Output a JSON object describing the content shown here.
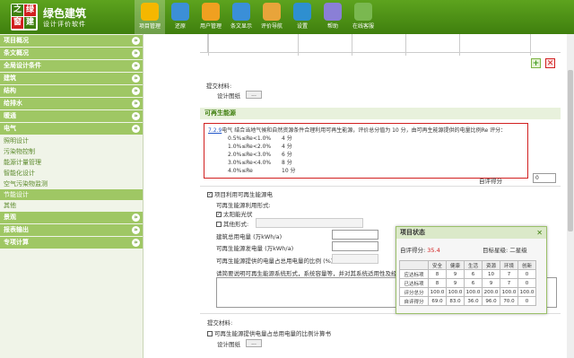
{
  "app": {
    "title_line1": "绿色建筑",
    "title_line2": "设计评价软件",
    "logo_chars": [
      "之",
      "绿",
      "窗",
      "建"
    ]
  },
  "toolbar": [
    {
      "label": "项目管理",
      "icon": "folder-icon",
      "color": "#f5b700",
      "name": "toolbar-project-management"
    },
    {
      "label": "还原",
      "icon": "refresh-icon",
      "color": "#3c8fd6",
      "name": "toolbar-restore"
    },
    {
      "label": "用户管理",
      "icon": "user-icon",
      "color": "#f0a020",
      "name": "toolbar-user-management"
    },
    {
      "label": "条文显示",
      "icon": "document-icon",
      "color": "#3a8fd8",
      "name": "toolbar-clause-display"
    },
    {
      "label": "评价导航",
      "icon": "navigation-icon",
      "color": "#e8a43a",
      "name": "toolbar-evaluation-nav"
    },
    {
      "label": "设置",
      "icon": "gear-icon",
      "color": "#2e8fd0",
      "name": "toolbar-settings"
    },
    {
      "label": "帮助",
      "icon": "help-icon",
      "color": "#8a7fd6",
      "name": "toolbar-help"
    },
    {
      "label": "在线客服",
      "icon": "support-icon",
      "color": "#7ab850",
      "name": "toolbar-online-service"
    }
  ],
  "sidebar": {
    "groups": [
      {
        "label": "项目概况",
        "toggle": "»"
      },
      {
        "label": "条文概况",
        "toggle": "»"
      },
      {
        "label": "全局设计条件",
        "toggle": "»"
      },
      {
        "label": "建筑",
        "toggle": "»"
      },
      {
        "label": "结构",
        "toggle": "»"
      },
      {
        "label": "给排水",
        "toggle": "»"
      },
      {
        "label": "暖通",
        "toggle": "»"
      },
      {
        "label": "电气",
        "toggle": "«"
      }
    ],
    "sub_items": [
      "照明设计",
      "污染物控制",
      "能源计量管理",
      "智能化设计",
      "空气污染物监测",
      "节能设计",
      "其他"
    ],
    "active_sub": "节能设计",
    "groups_after": [
      {
        "label": "景观",
        "toggle": "»"
      },
      {
        "label": "报表输出",
        "toggle": "»"
      },
      {
        "label": "专项计算",
        "toggle": "»"
      }
    ]
  },
  "main": {
    "materials_label": "提交材料:",
    "drawing_label": "设计图纸",
    "browse_label": "...",
    "section_title": "可再生能源",
    "clause": {
      "code": "7.2.9",
      "text": "电气 结合当地气候和自然资源条件合理利用可再生能源，评价总分值为 10 分，由可再生能源提供的电量比例Re 评分：",
      "rows": [
        {
          "range": "0.5%≤Re<1.0%",
          "score": "4 分"
        },
        {
          "range": "1.0%≤Re<2.0%",
          "score": "4 分"
        },
        {
          "range": "2.0%≤Re<3.0%",
          "score": "6 分"
        },
        {
          "range": "3.0%≤Re<4.0%",
          "score": "8 分"
        },
        {
          "range": "4.0%≤Re",
          "score": "10 分"
        }
      ]
    },
    "self_score_label": "自评得分",
    "self_score_value": "0",
    "use_renewable_label": "项目利用可再生能源电",
    "form_section_label": "可再生能源利用形式:",
    "solar_pv_label": "太阳能光伏",
    "other_form_label": "其他形式:",
    "building_power_label": "建筑总用电量 (万kWh/a)",
    "renewable_power_label": "可再生能源发电量 (万kWh/a)",
    "ratio_label": "可再生能源提供的电量占总用电量的比例 (%):",
    "describe_label": "请简要说明可再生能源系统形式，系统容量等，并对其系统适用性及经济性进行简要说明",
    "materials_label2": "提交材料:",
    "calc_book_label": "可再生能源提供电量占总用电量的比例计算书",
    "drawing_label2": "设计图纸"
  },
  "status_panel": {
    "title": "项目状态",
    "close": "✕",
    "self_score_label": "自评得分:",
    "self_score_value": "35.4",
    "target_label": "目标星级:",
    "target_value": "二星级",
    "headers": [
      "",
      "安全",
      "健康",
      "生活",
      "资源",
      "环境",
      "创新"
    ],
    "rows": [
      [
        "应达标项",
        "8",
        "9",
        "6",
        "10",
        "7",
        "0"
      ],
      [
        "已达标项",
        "8",
        "9",
        "6",
        "9",
        "7",
        "0"
      ],
      [
        "评分总分",
        "100.0",
        "100.0",
        "100.0",
        "200.0",
        "100.0",
        "100.0"
      ],
      [
        "自评得分",
        "69.0",
        "83.0",
        "36.0",
        "96.0",
        "70.0",
        "0"
      ]
    ]
  }
}
